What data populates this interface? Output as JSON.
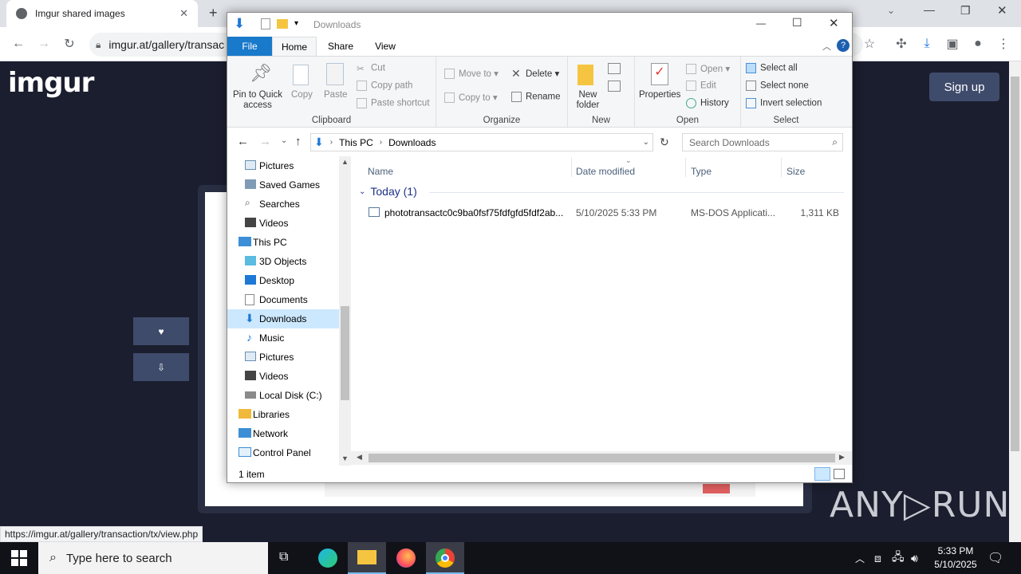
{
  "chrome": {
    "tab_title": "Imgur shared images",
    "url": "imgur.at/gallery/transac",
    "status_url": "https://imgur.at/gallery/transaction/tx/view.php"
  },
  "page": {
    "logo": "imgur",
    "signup": "Sign up",
    "fav_icon": "♥",
    "dl_icon": "⇩",
    "watermark": "ANY▷RUN"
  },
  "explorer": {
    "title": "Downloads",
    "tabs": [
      "File",
      "Home",
      "Share",
      "View"
    ],
    "clipboard": {
      "pin": "Pin to Quick access",
      "copy": "Copy",
      "paste": "Paste",
      "cut": "Cut",
      "copy_path": "Copy path",
      "paste_shortcut": "Paste shortcut",
      "label": "Clipboard"
    },
    "organize": {
      "move_to": "Move to",
      "copy_to": "Copy to",
      "delete": "Delete",
      "rename": "Rename",
      "label": "Organize"
    },
    "new": {
      "new_folder": "New folder",
      "label": "New"
    },
    "open": {
      "properties": "Properties",
      "open": "Open",
      "edit": "Edit",
      "history": "History",
      "label": "Open"
    },
    "select": {
      "select_all": "Select all",
      "select_none": "Select none",
      "invert": "Invert selection",
      "label": "Select"
    },
    "breadcrumb": [
      "This PC",
      "Downloads"
    ],
    "search_placeholder": "Search Downloads",
    "nav": [
      "Pictures",
      "Saved Games",
      "Searches",
      "Videos",
      "This PC",
      "3D Objects",
      "Desktop",
      "Documents",
      "Downloads",
      "Music",
      "Pictures",
      "Videos",
      "Local Disk (C:)",
      "Libraries",
      "Network",
      "Control Panel"
    ],
    "columns": {
      "name": "Name",
      "date": "Date modified",
      "type": "Type",
      "size": "Size"
    },
    "group": "Today (1)",
    "file": {
      "name": "phototransactc0c9ba0fsf75fdfgfd5fdf2ab...",
      "date": "5/10/2025 5:33 PM",
      "type": "MS-DOS Applicati...",
      "size": "1,311 KB"
    },
    "status": "1 item"
  },
  "taskbar": {
    "search": "Type here to search",
    "time": "5:33 PM",
    "date": "5/10/2025"
  }
}
